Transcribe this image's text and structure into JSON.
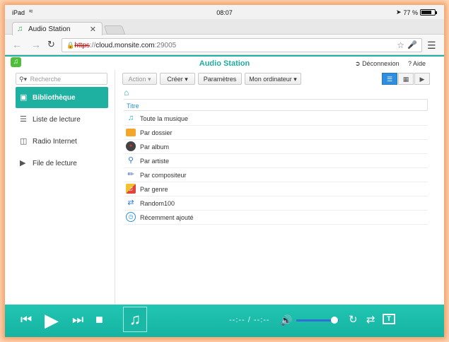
{
  "status_bar": {
    "device": "iPad",
    "wifi_icon": "wifi-icon",
    "time": "08:07",
    "battery": "77 %",
    "battery_level": 0.77
  },
  "browser": {
    "tab_title": "Audio Station",
    "url_scheme": "https",
    "url_rest": "://",
    "url_host": "cloud.monsite.com",
    "url_port": ":29005"
  },
  "app": {
    "title": "Audio Station",
    "logout_label": "Déconnexion",
    "help_label": "Aide",
    "accent_color": "#1eb1a2"
  },
  "sidebar": {
    "search_placeholder": "Recherche",
    "items": [
      {
        "label": "Bibliothèque",
        "icon": "library-icon",
        "active": true
      },
      {
        "label": "Liste de lecture",
        "icon": "playlist-icon",
        "active": false
      },
      {
        "label": "Radio Internet",
        "icon": "radio-icon",
        "active": false
      },
      {
        "label": "File de lecture",
        "icon": "play-queue-icon",
        "active": false
      }
    ]
  },
  "toolbar": {
    "action_label": "Action",
    "create_label": "Créer",
    "settings_label": "Paramètres",
    "computer_label": "Mon ordinateur",
    "views": [
      "list-view-icon",
      "grid-view-icon",
      "cover-view-icon"
    ]
  },
  "list": {
    "column_title": "Titre",
    "rows": [
      {
        "label": "Toute la musique",
        "icon": "music-note-icon"
      },
      {
        "label": "Par dossier",
        "icon": "folder-icon"
      },
      {
        "label": "Par album",
        "icon": "album-icon"
      },
      {
        "label": "Par artiste",
        "icon": "microphone-icon"
      },
      {
        "label": "Par compositeur",
        "icon": "composer-icon"
      },
      {
        "label": "Par genre",
        "icon": "genre-icon"
      },
      {
        "label": "Random100",
        "icon": "shuffle-icon"
      },
      {
        "label": "Récemment ajouté",
        "icon": "clock-icon"
      }
    ]
  },
  "player": {
    "time": "--:-- / --:--",
    "volume": 0.85
  }
}
